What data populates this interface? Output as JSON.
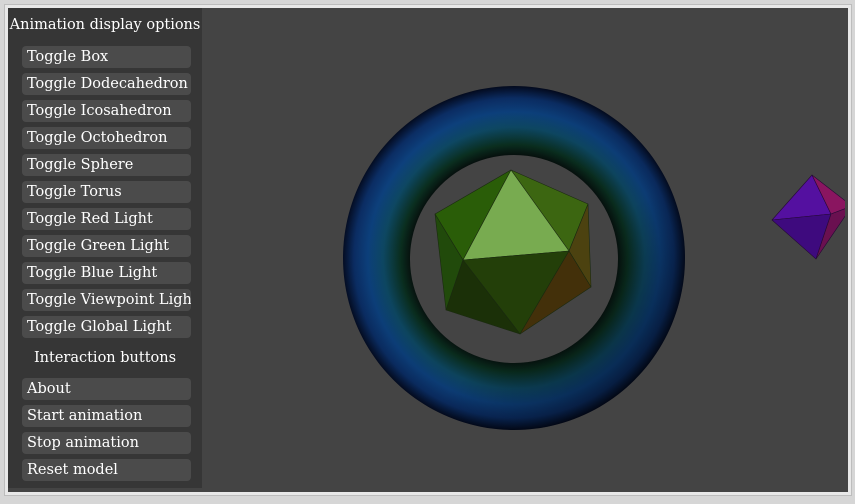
{
  "sidebar": {
    "display_title": "Animation display options",
    "display_buttons": [
      "Toggle Box",
      "Toggle Dodecahedron",
      "Toggle Icosahedron",
      "Toggle Octohedron",
      "Toggle Sphere",
      "Toggle Torus",
      "Toggle Red Light",
      "Toggle Green Light",
      "Toggle Blue Light",
      "Toggle Viewpoint Light",
      "Toggle Global Light"
    ],
    "interaction_title": "Interaction buttons",
    "interaction_buttons": [
      "About",
      "Start animation",
      "Stop animation",
      "Reset model"
    ]
  },
  "scene": {
    "background_color": "#444444",
    "objects": [
      "torus",
      "icosahedron",
      "octahedron"
    ]
  }
}
